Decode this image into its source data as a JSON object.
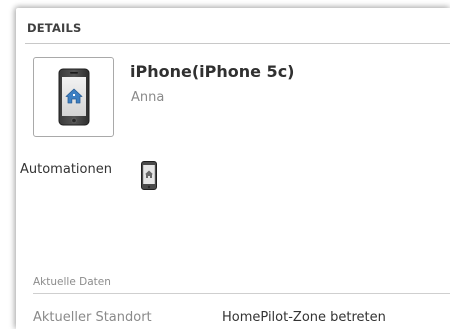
{
  "panel": {
    "header": "DETAILS"
  },
  "device": {
    "name": "iPhone(iPhone 5c)",
    "owner": "Anna",
    "icon": "phone-home-icon"
  },
  "automation": {
    "label": "Automationen",
    "icon": "phone-home-icon"
  },
  "current_data": {
    "section_label": "Aktuelle Daten",
    "rows": [
      {
        "key": "Aktueller Standort",
        "value": "HomePilot-Zone betreten"
      }
    ]
  }
}
